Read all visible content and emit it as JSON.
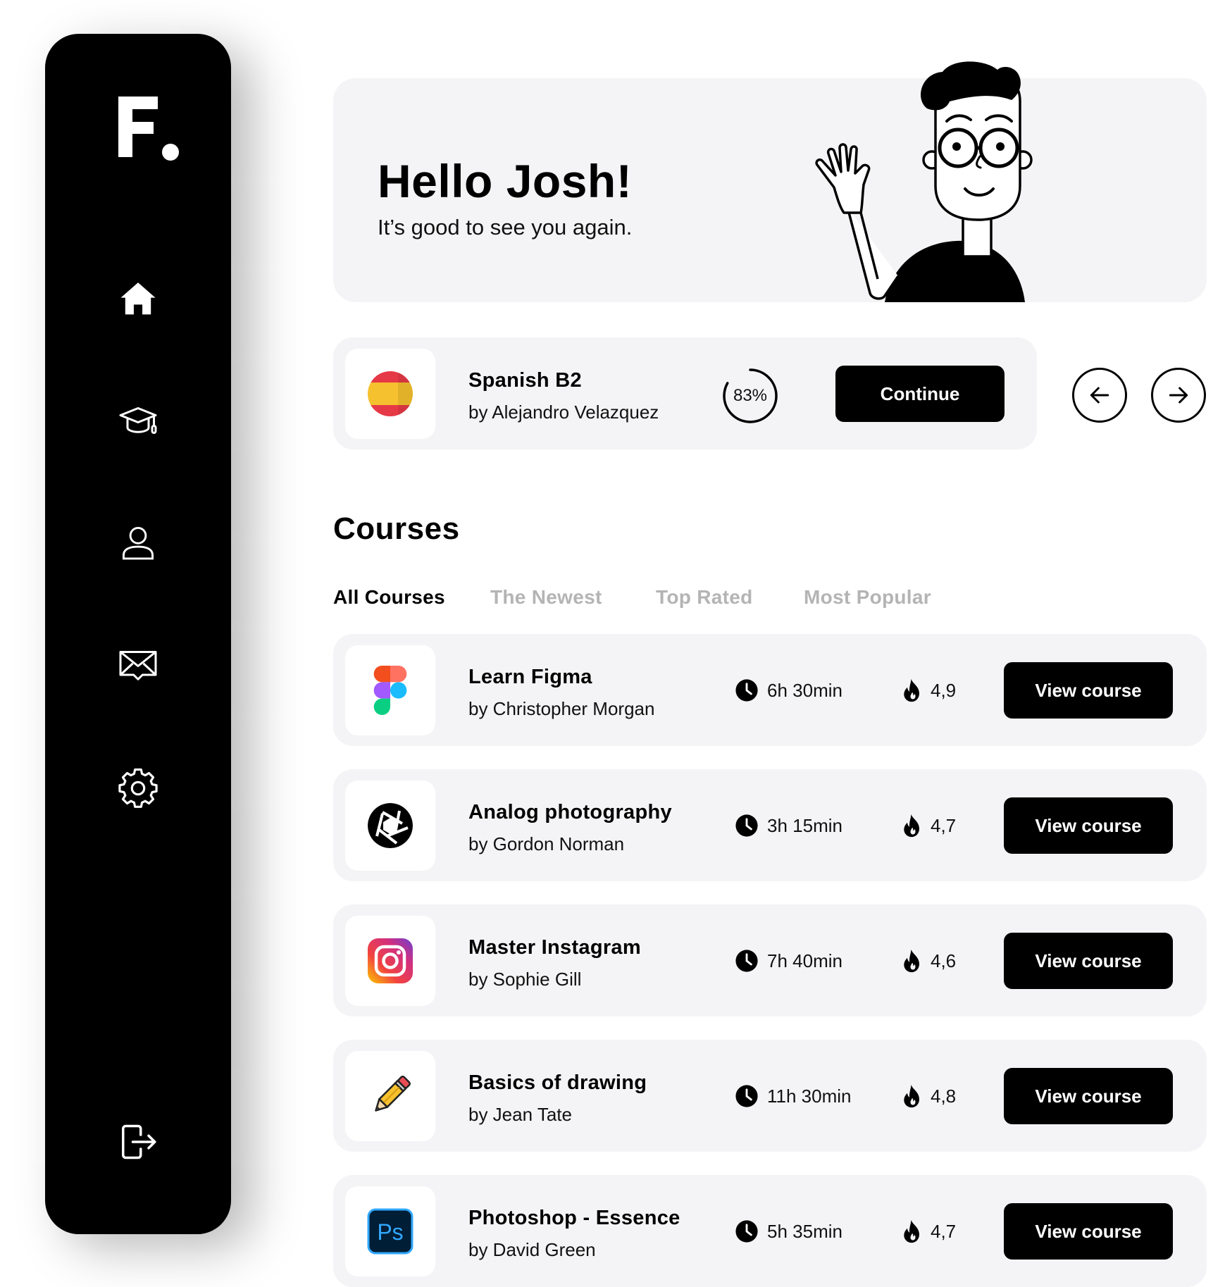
{
  "sidebar": {
    "logo_text": "F.",
    "icons": [
      "home-icon",
      "graduation-cap-icon",
      "user-icon",
      "mail-icon",
      "gear-icon",
      "logout-icon"
    ]
  },
  "hero": {
    "title": "Hello Josh!",
    "subtitle": "It’s good to see you again."
  },
  "current_course": {
    "title": "Spanish B2",
    "author": "by Alejandro Velazquez",
    "progress": 83,
    "progress_label": "83%",
    "button_label": "Continue"
  },
  "carousel": {
    "prev_icon": "arrow-left-icon",
    "next_icon": "arrow-right-icon"
  },
  "courses": {
    "heading": "Courses",
    "tabs": [
      {
        "label": "All Courses",
        "active": true
      },
      {
        "label": "The Newest",
        "active": false
      },
      {
        "label": "Top Rated",
        "active": false
      },
      {
        "label": "Most Popular",
        "active": false
      }
    ],
    "items": [
      {
        "title": "Learn Figma",
        "author": "by Christopher Morgan",
        "duration": "6h 30min",
        "rating": "4,9",
        "button": "View course",
        "icon": "figma-icon"
      },
      {
        "title": "Analog photography",
        "author": "by Gordon Norman",
        "duration": "3h 15min",
        "rating": "4,7",
        "button": "View course",
        "icon": "camera-aperture-icon"
      },
      {
        "title": "Master Instagram",
        "author": "by Sophie Gill",
        "duration": "7h 40min",
        "rating": "4,6",
        "button": "View course",
        "icon": "instagram-icon"
      },
      {
        "title": "Basics of drawing",
        "author": "by Jean Tate",
        "duration": "11h 30min",
        "rating": "4,8",
        "button": "View course",
        "icon": "pencil-icon"
      },
      {
        "title": "Photoshop - Essence",
        "author": "by David Green",
        "duration": "5h 35min",
        "rating": "4,7",
        "button": "View course",
        "icon": "photoshop-icon"
      }
    ]
  },
  "colors": {
    "background": "#ffffff",
    "sidebar": "#000000",
    "card": "#f4f4f6",
    "button": "#000000",
    "inactive_tab": "#b4b4b4"
  }
}
